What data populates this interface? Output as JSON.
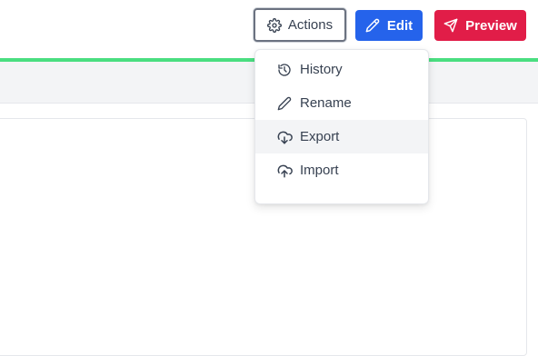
{
  "toolbar": {
    "actions_label": "Actions",
    "actions_icon": "gear-icon",
    "edit_label": "Edit",
    "edit_icon": "pencil-icon",
    "preview_label": "Preview",
    "preview_icon": "paper-plane-icon"
  },
  "dropdown": {
    "items": [
      {
        "label": "History",
        "icon": "history-icon"
      },
      {
        "label": "Rename",
        "icon": "pencil-icon"
      },
      {
        "label": "Export",
        "icon": "cloud-download-icon",
        "highlighted": true
      },
      {
        "label": "Import",
        "icon": "cloud-upload-icon"
      }
    ]
  },
  "colors": {
    "green_bar": "#4ade80",
    "edit_button": "#2563eb",
    "preview_button": "#e11d48",
    "subbar": "#f3f4f6",
    "highlight_row": "#f3f4f6"
  }
}
